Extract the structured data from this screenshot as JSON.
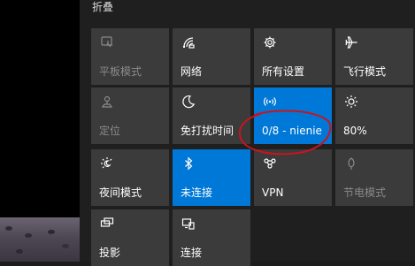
{
  "panel": {
    "collapse_label": "折叠"
  },
  "tiles": [
    {
      "label": "平板模式",
      "icon": "tablet-mode-icon",
      "state": "disabled"
    },
    {
      "label": "网络",
      "icon": "network-icon",
      "state": "normal"
    },
    {
      "label": "所有设置",
      "icon": "gear-icon",
      "state": "normal"
    },
    {
      "label": "飞行模式",
      "icon": "airplane-icon",
      "state": "normal"
    },
    {
      "label": "定位",
      "icon": "location-icon",
      "state": "disabled"
    },
    {
      "label": "免打扰时间",
      "icon": "moon-icon",
      "state": "normal"
    },
    {
      "label": "0/8 - nienie",
      "icon": "mobile-hotspot-icon",
      "state": "active"
    },
    {
      "label": "80%",
      "icon": "brightness-icon",
      "state": "normal"
    },
    {
      "label": "夜间模式",
      "icon": "night-light-icon",
      "state": "normal"
    },
    {
      "label": "未连接",
      "icon": "bluetooth-icon",
      "state": "active"
    },
    {
      "label": "VPN",
      "icon": "vpn-icon",
      "state": "normal"
    },
    {
      "label": "节电模式",
      "icon": "battery-saver-icon",
      "state": "disabled"
    },
    {
      "label": "投影",
      "icon": "project-icon",
      "state": "normal"
    },
    {
      "label": "连接",
      "icon": "connect-icon",
      "state": "normal"
    }
  ],
  "colors": {
    "tile_bg": "#3b3b3b",
    "tile_active_bg": "#0078d7",
    "panel_bg": "#1f1f1f",
    "annotation_red": "#c8141e"
  }
}
